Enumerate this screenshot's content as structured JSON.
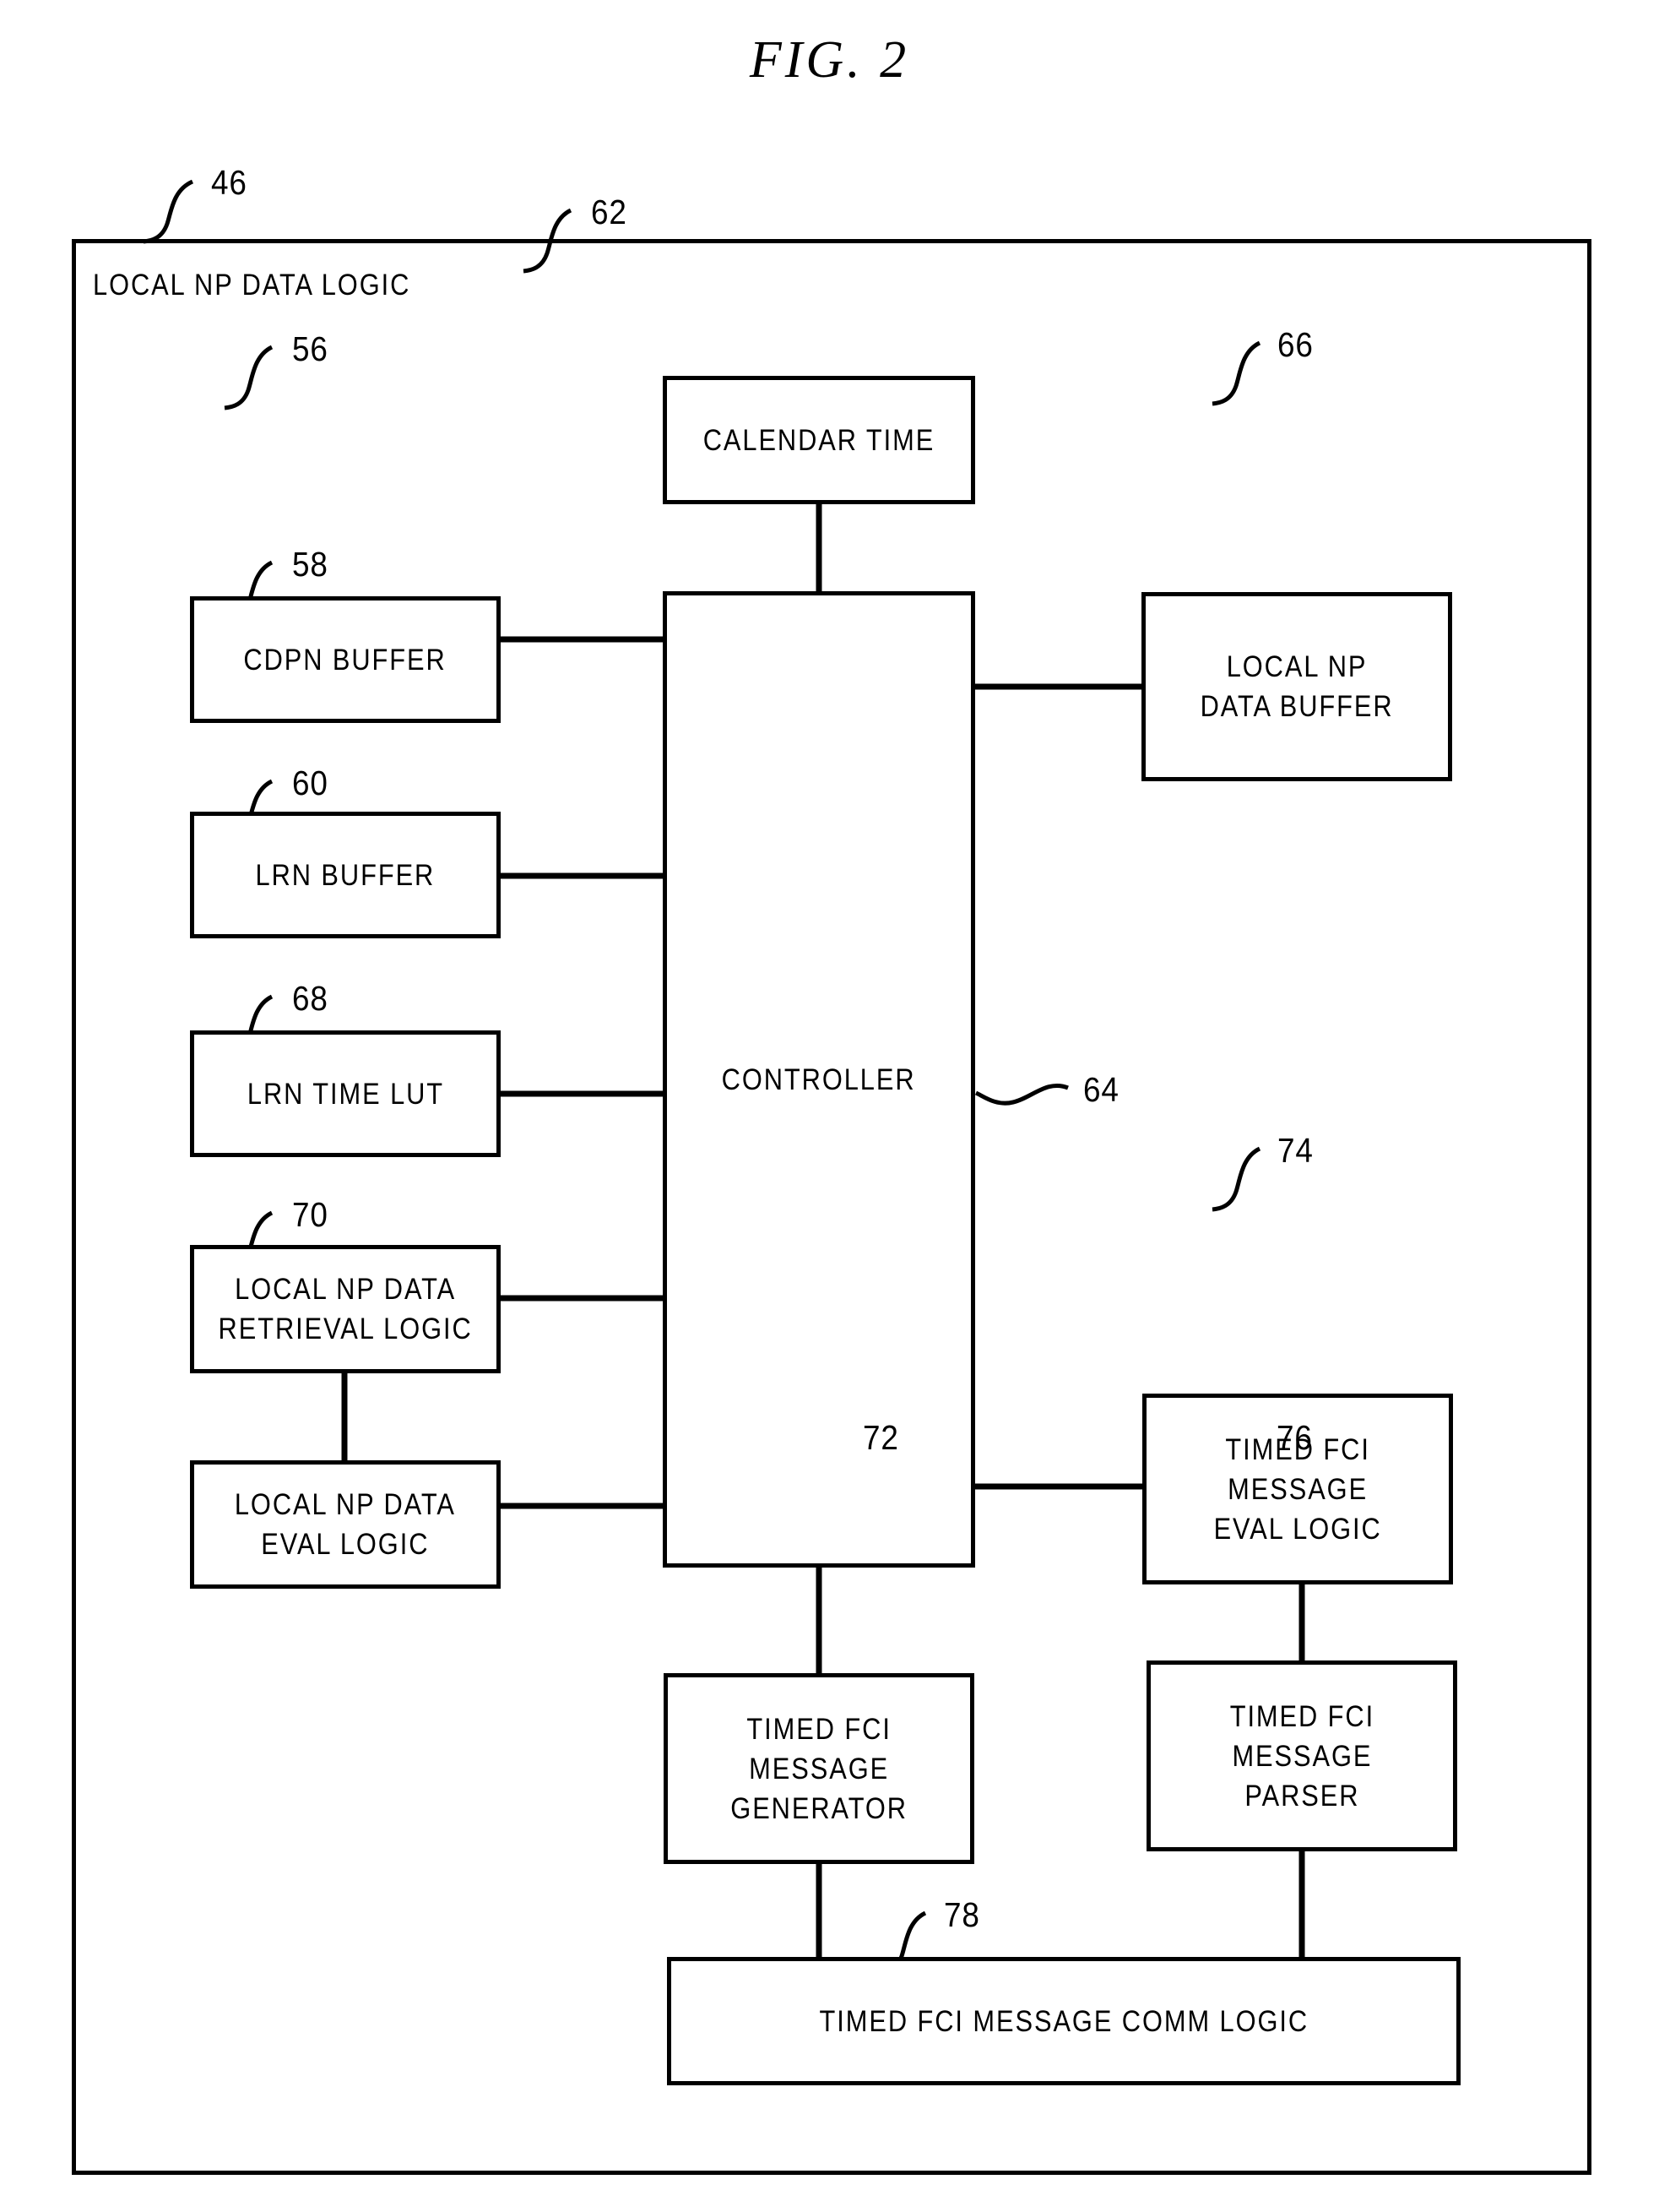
{
  "figure": {
    "title": "FIG.  2",
    "outer": {
      "label": "LOCAL NP DATA LOGIC",
      "ref": "46"
    },
    "blocks": [
      {
        "id": "calendar-time",
        "label": "CALENDAR TIME",
        "ref": "62"
      },
      {
        "id": "cdpn-buffer",
        "label": "CDPN BUFFER",
        "ref": "56"
      },
      {
        "id": "lrn-buffer",
        "label": "LRN BUFFER",
        "ref": "58"
      },
      {
        "id": "lrn-time-lut",
        "label": "LRN TIME LUT",
        "ref": "60"
      },
      {
        "id": "local-np-data-retrieval",
        "label": "LOCAL NP DATA\nRETRIEVAL LOGIC",
        "ref": "68"
      },
      {
        "id": "local-np-data-eval",
        "label": "LOCAL NP DATA\nEVAL LOGIC",
        "ref": "70"
      },
      {
        "id": "controller",
        "label": "CONTROLLER",
        "ref": "64"
      },
      {
        "id": "local-np-data-buffer",
        "label": "LOCAL NP\nDATA BUFFER",
        "ref": "66"
      },
      {
        "id": "timed-fci-eval-logic",
        "label": "TIMED FCI\nMESSAGE\nEVAL LOGIC",
        "ref": "74"
      },
      {
        "id": "timed-fci-generator",
        "label": "TIMED FCI\nMESSAGE\nGENERATOR",
        "ref": "72"
      },
      {
        "id": "timed-fci-parser",
        "label": "TIMED FCI\nMESSAGE\nPARSER",
        "ref": "76"
      },
      {
        "id": "timed-fci-comm-logic",
        "label": "TIMED FCI MESSAGE COMM LOGIC",
        "ref": "78"
      }
    ],
    "colors": {
      "ink": "#000000",
      "paper": "#ffffff"
    }
  }
}
